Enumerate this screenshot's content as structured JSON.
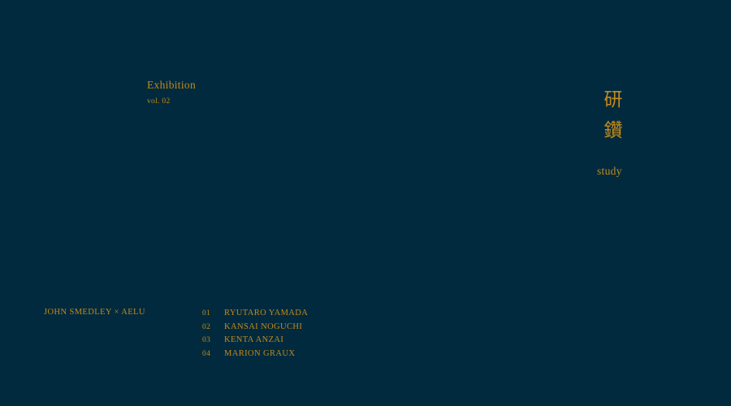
{
  "colors": {
    "background": "#012a3e",
    "accent": "#c48a1a"
  },
  "exhibition": {
    "title": "Exhibition",
    "volume": "vol. 02"
  },
  "kanji": {
    "chars": [
      "研",
      "鑽"
    ],
    "translation": "study"
  },
  "collaboration": "JOHN SMEDLEY × AELU",
  "artists": [
    {
      "number": "01",
      "name": "RYUTARO YAMADA"
    },
    {
      "number": "02",
      "name": "KANSAI NOGUCHI"
    },
    {
      "number": "03",
      "name": "KENTA ANZAI"
    },
    {
      "number": "04",
      "name": "MARION GRAUX"
    }
  ]
}
